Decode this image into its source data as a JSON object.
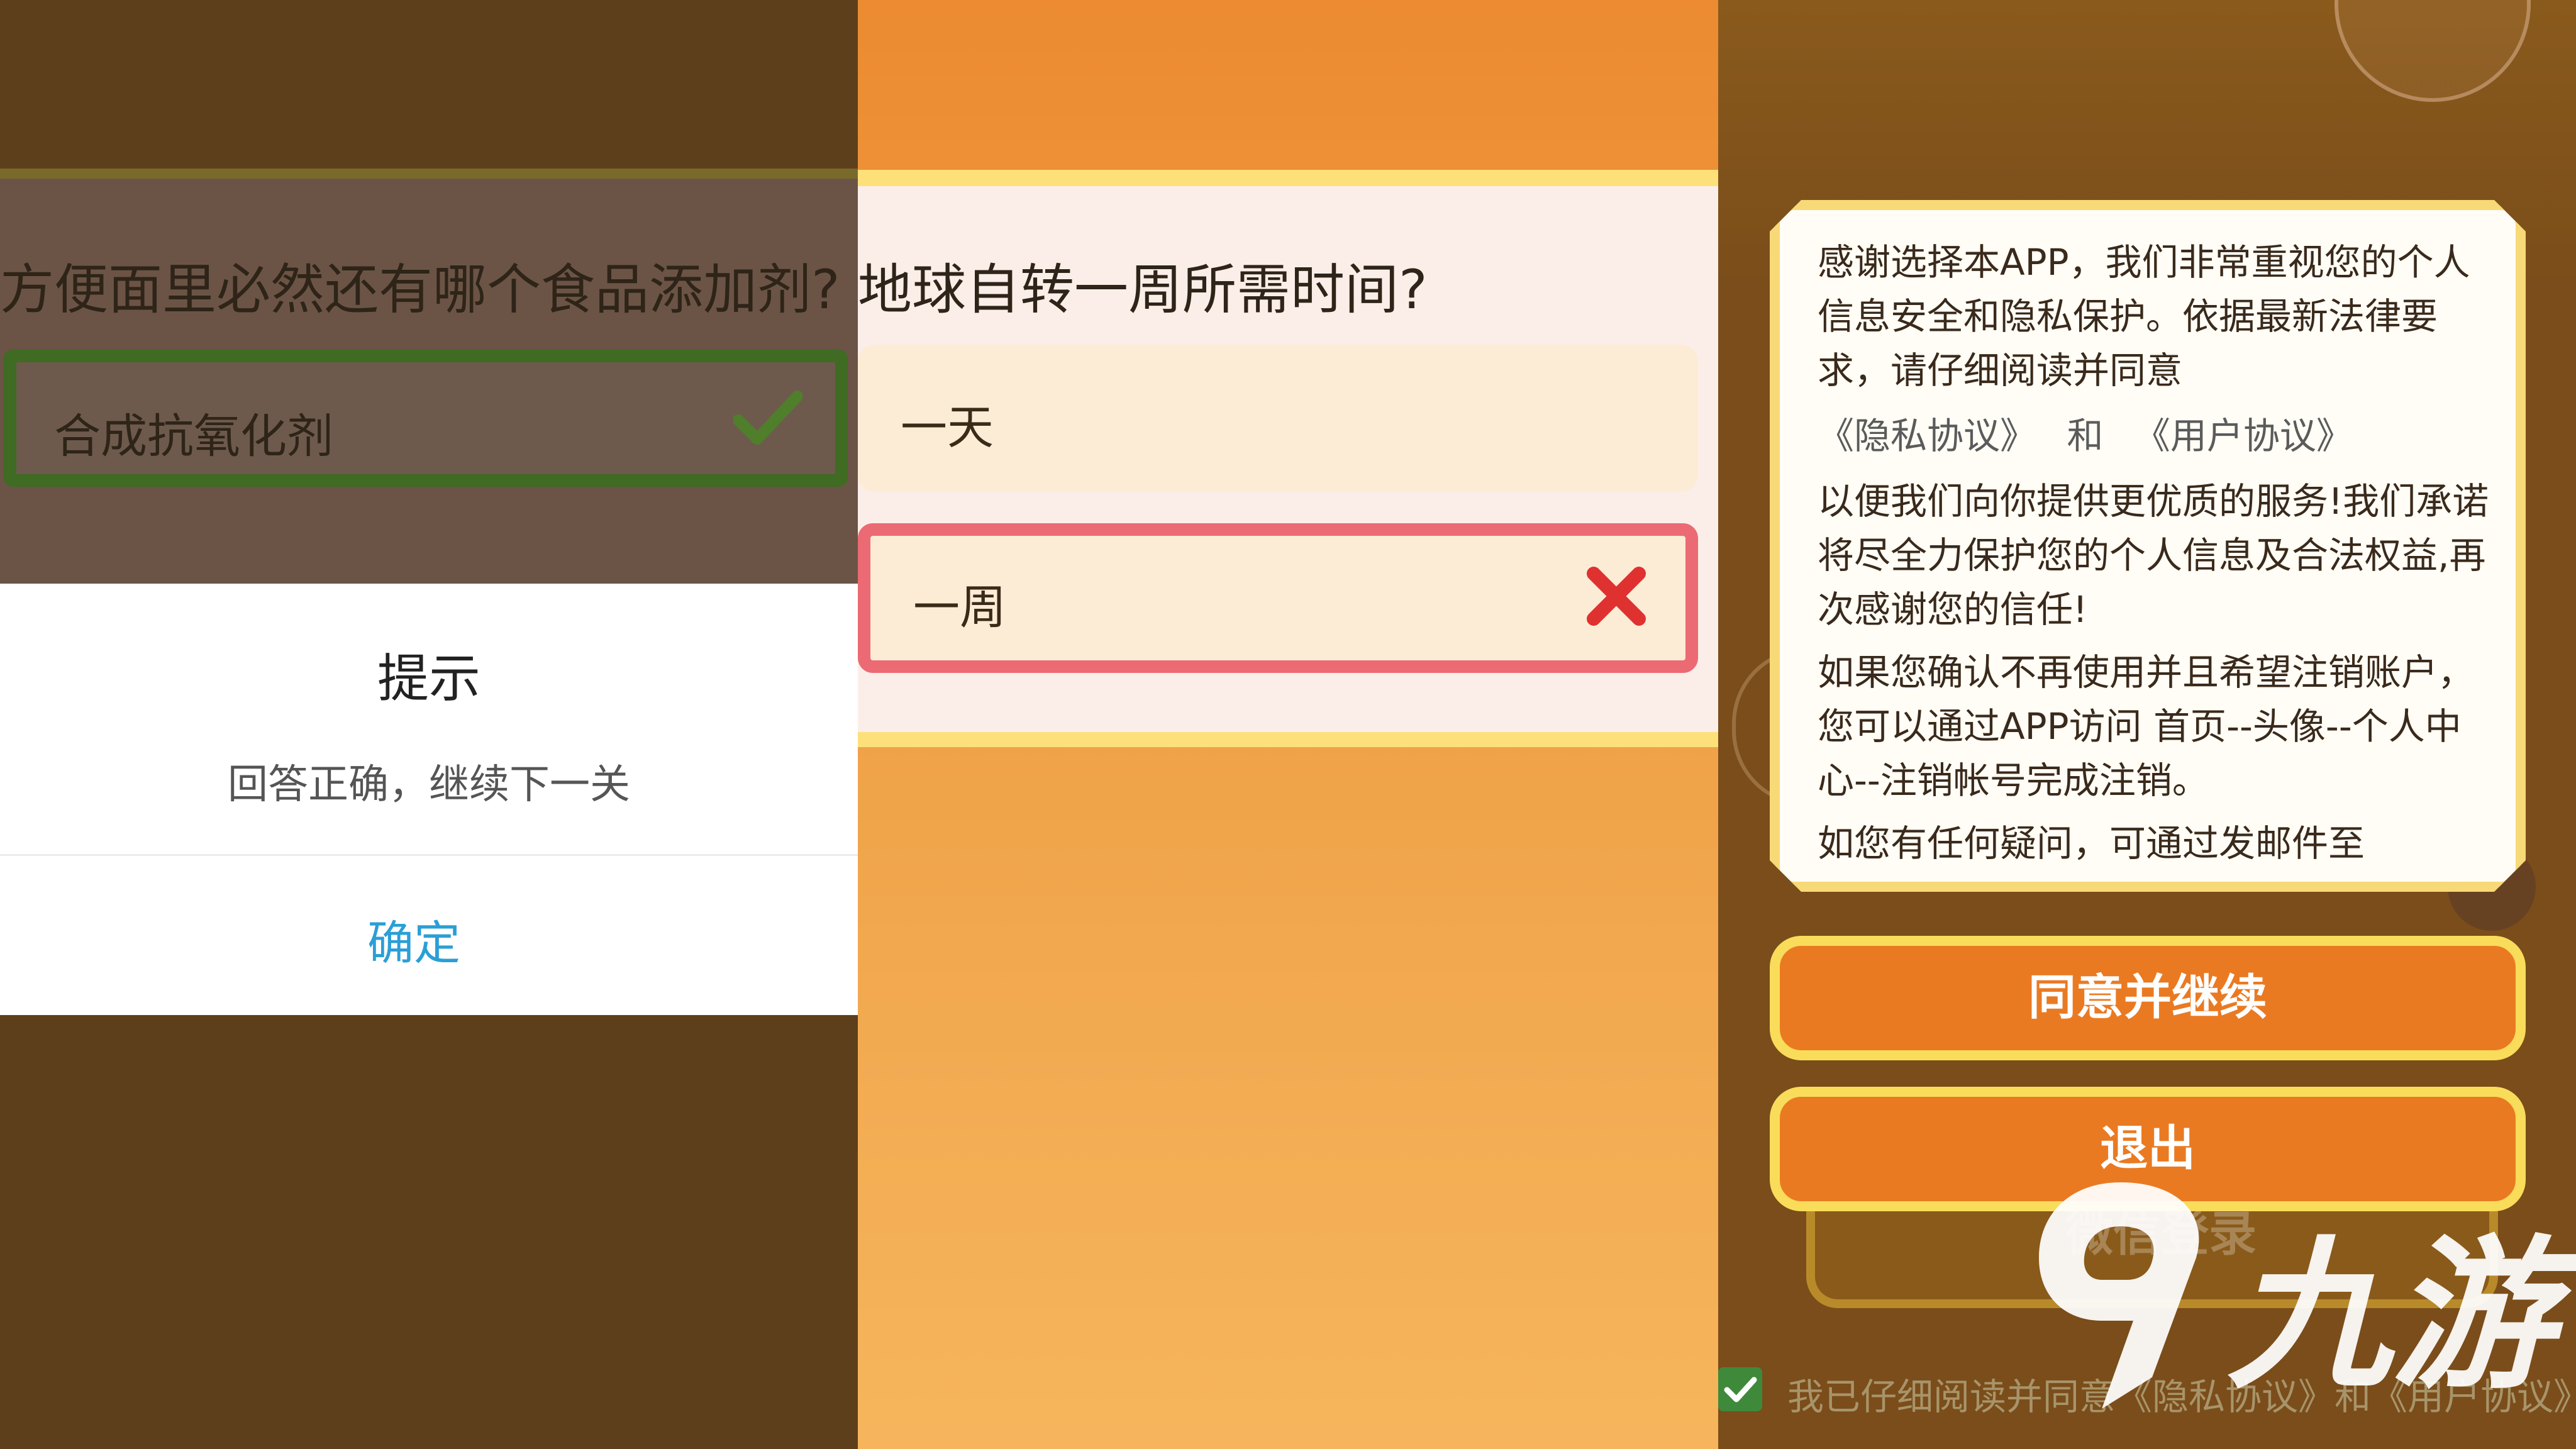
{
  "panel_left": {
    "question": "方便面里必然还有哪个食品添加剂?",
    "answer": "合成抗氧化剂",
    "answer_status_icon": "checkmark-icon",
    "dialog": {
      "title": "提示",
      "message": "回答正确，继续下一关",
      "ok_label": "确定"
    }
  },
  "panel_middle": {
    "question": "地球自转一周所需时间?",
    "options": [
      {
        "label": "一天"
      },
      {
        "label": "一周",
        "status_icon": "cross-icon"
      }
    ]
  },
  "panel_right": {
    "notice": {
      "para1": "感谢选择本APP，我们非常重视您的个人信息安全和隐私保护。依据最新法律要求，请仔细阅读并同意",
      "privacy_link": "《隐私协议》",
      "and_text": "和",
      "user_link": "《用户协议》",
      "para2": "以便我们向你提供更优质的服务!我们承诺将尽全力保护您的个人信息及合法权益,再次感谢您的信任!",
      "para3": "如果您确认不再使用并且希望注销账户，您可以通过APP访问 首页--头像--个人中心--注销帐号完成注销。",
      "para4": "如您有任何疑问，可通过发邮件至"
    },
    "agree_button": "同意并继续",
    "exit_button": "退出",
    "wechat_login": "微信登录",
    "agreement_check": "我已仔细阅读并同意《隐私协议》和《用户协议》",
    "watermark": "九游"
  },
  "colors": {
    "correct_green": "#3f6b22",
    "wrong_red": "#ec6a73",
    "dialog_link_blue": "#2a9fd6",
    "button_orange": "#ea7a22",
    "button_border_yellow": "#f9dc5a"
  }
}
